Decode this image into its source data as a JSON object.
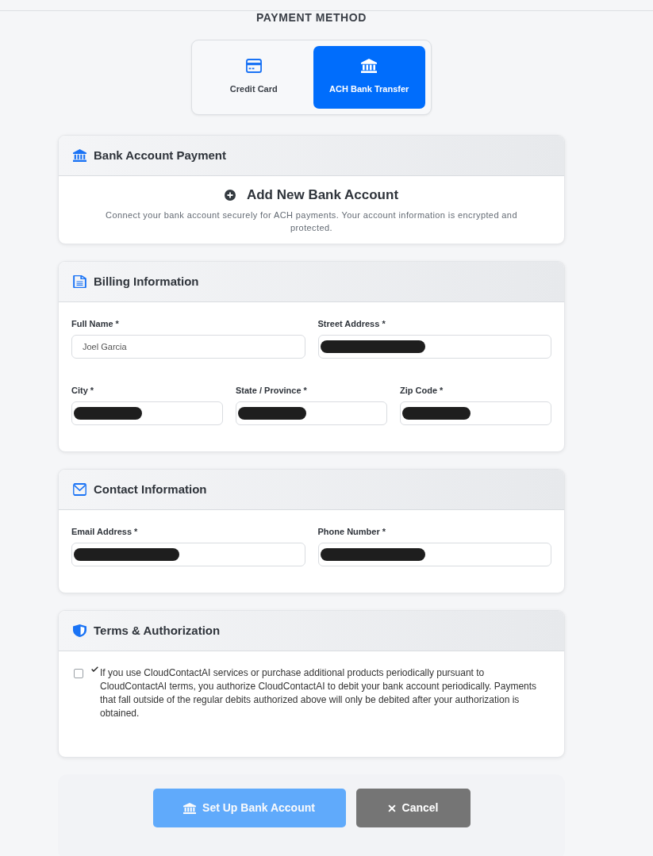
{
  "title": "PAYMENT METHOD",
  "methods": [
    {
      "label": "Credit Card",
      "selected": false
    },
    {
      "label": "ACH Bank Transfer",
      "selected": true
    }
  ],
  "sections": [
    {
      "kind": "intro",
      "title": "Bank Account Payment",
      "action": "Add New Bank Account",
      "description": "Connect your bank account securely for ACH payments. Your account information is encrypted and protected."
    },
    {
      "kind": "form",
      "title": "Billing Information",
      "rows": [
        [
          {
            "label": "Full Name *",
            "value": "Joel Garcia",
            "redacted": false
          },
          {
            "label": "Street Address *",
            "redacted": true
          }
        ],
        [
          {
            "label": "City *",
            "redacted": true
          },
          {
            "label": "State / Province *",
            "redacted": true
          },
          {
            "label": "Zip Code *",
            "redacted": true
          }
        ]
      ]
    },
    {
      "kind": "form",
      "title": "Contact Information",
      "rows": [
        [
          {
            "label": "Email Address *",
            "redacted": true
          },
          {
            "label": "Phone Number *",
            "redacted": true
          }
        ]
      ]
    },
    {
      "kind": "consent",
      "title": "Terms & Authorization",
      "checked": false,
      "text": "If you use CloudContactAI services or purchase additional products periodically pursuant to CloudContactAI terms, you authorize CloudContactAI to debit your bank account periodically. Payments that fall outside of the regular debits authorized above will only be debited after your authorization is obtained."
    }
  ],
  "buttons": [
    {
      "kind": "submit",
      "label": "Set Up Bank Account",
      "disabled": true
    },
    {
      "kind": "cancel",
      "label": "Cancel",
      "disabled": false
    }
  ]
}
